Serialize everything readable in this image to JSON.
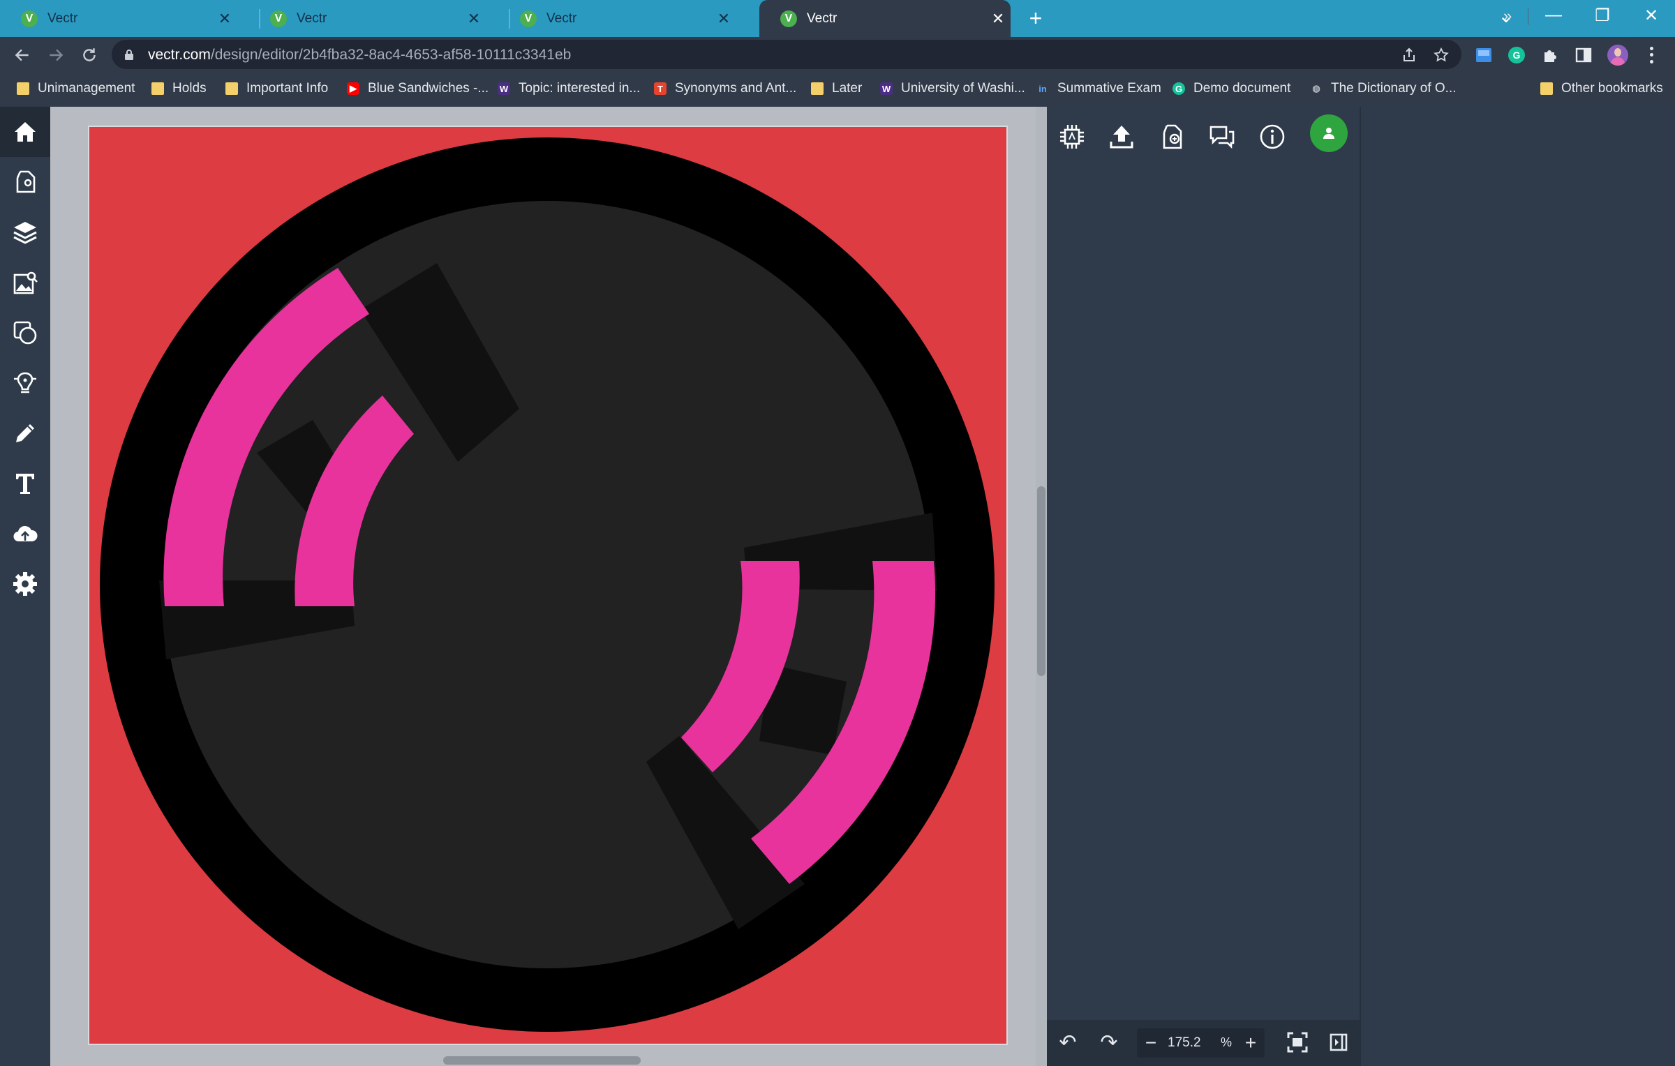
{
  "tabs": [
    {
      "title": "Vectr",
      "favicon": "V",
      "active": false
    },
    {
      "title": "Vectr",
      "favicon": "V",
      "active": false
    },
    {
      "title": "Vectr",
      "favicon": "V",
      "active": false
    },
    {
      "title": "Vectr",
      "favicon": "V",
      "active": true
    }
  ],
  "tab_close": "✕",
  "new_tab": "+",
  "window_controls": {
    "tab_search": "⌄",
    "minimize": "—",
    "restore": "❐",
    "close": "✕"
  },
  "address_bar": {
    "host": "vectr.com",
    "path": "/design/editor/2b4fba32-8ac4-4653-af58-10111c3341eb"
  },
  "bookmarks": [
    {
      "label": "Unimanagement",
      "icon": "folder-icon"
    },
    {
      "label": "Holds",
      "icon": "folder-icon"
    },
    {
      "label": "Important Info",
      "icon": "folder-icon"
    },
    {
      "label": "Blue Sandwiches -...",
      "icon": "youtube-icon"
    },
    {
      "label": "Topic: interested in...",
      "icon": "uw-icon"
    },
    {
      "label": "Synonyms and Ant...",
      "icon": "thesaurus-icon"
    },
    {
      "label": "Later",
      "icon": "folder-icon"
    },
    {
      "label": "University of Washi...",
      "icon": "uw-icon"
    },
    {
      "label": "Summative Exam",
      "icon": "linkedin-icon"
    },
    {
      "label": "Demo document",
      "icon": "grammarly-icon"
    },
    {
      "label": "The Dictionary of O...",
      "icon": "globe-icon"
    }
  ],
  "bookmarks_more": "»",
  "other_bookmarks": "Other bookmarks",
  "bookmark_icon_glyphs": {
    "youtube-icon": "▶",
    "uw-icon": "W",
    "thesaurus-icon": "T",
    "linkedin-icon": "in",
    "grammarly-icon": "G",
    "globe-icon": "◍"
  },
  "colors": {
    "tabstrip": "#2b9ac0",
    "artboard_bg": "#dd3c42",
    "ring": "#000000",
    "disc": "#222222",
    "shadow_block": "#111111",
    "arc_pink": "#e8339c",
    "avatar_green": "#2ea53f"
  },
  "zoom": {
    "value": "175.2",
    "unit": "%",
    "minus": "−",
    "plus": "+"
  },
  "bottom_bar": {
    "undo": "↶",
    "redo": "↷"
  }
}
